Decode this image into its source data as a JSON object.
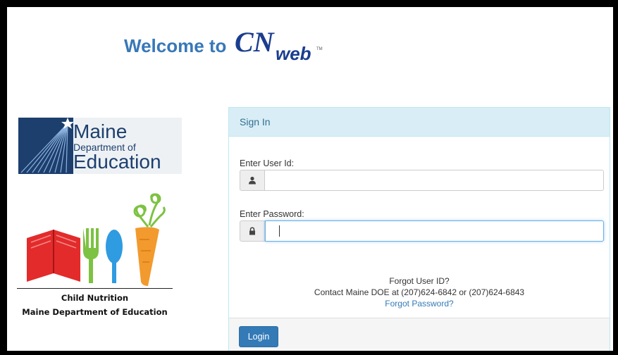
{
  "header": {
    "welcome_text": "Welcome to",
    "logo_text": "CNPweb"
  },
  "maine_logo": {
    "name": "Maine",
    "dept": "Department of",
    "edu": "Education"
  },
  "child_nutrition": {
    "line1": "Child Nutrition",
    "line2": "Maine Department of Education"
  },
  "signin": {
    "title": "Sign In",
    "user_label": "Enter User Id:",
    "user_value": "",
    "password_label": "Enter Password:",
    "password_value": "",
    "forgot_user": "Forgot User ID?",
    "contact": "Contact Maine DOE at (207)624-6842 or (207)624-6843",
    "forgot_password": "Forgot Password?",
    "login_label": "Login"
  },
  "colors": {
    "welcome_blue": "#3878b8",
    "panel_header_bg": "#d9edf7",
    "button_blue": "#337ab7"
  }
}
